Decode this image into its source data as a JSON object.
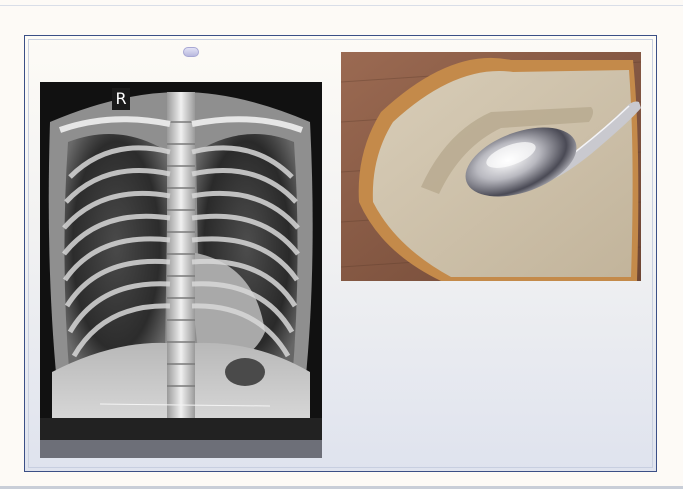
{
  "xray": {
    "marker_label": "R"
  },
  "images": {
    "left": "chest-xray-image",
    "right": "bread-with-spoon-image"
  },
  "colors": {
    "slide_border": "#3b4f86",
    "slide_background_bottom": "#dfe3ee",
    "page_background": "#fdfaf6"
  }
}
